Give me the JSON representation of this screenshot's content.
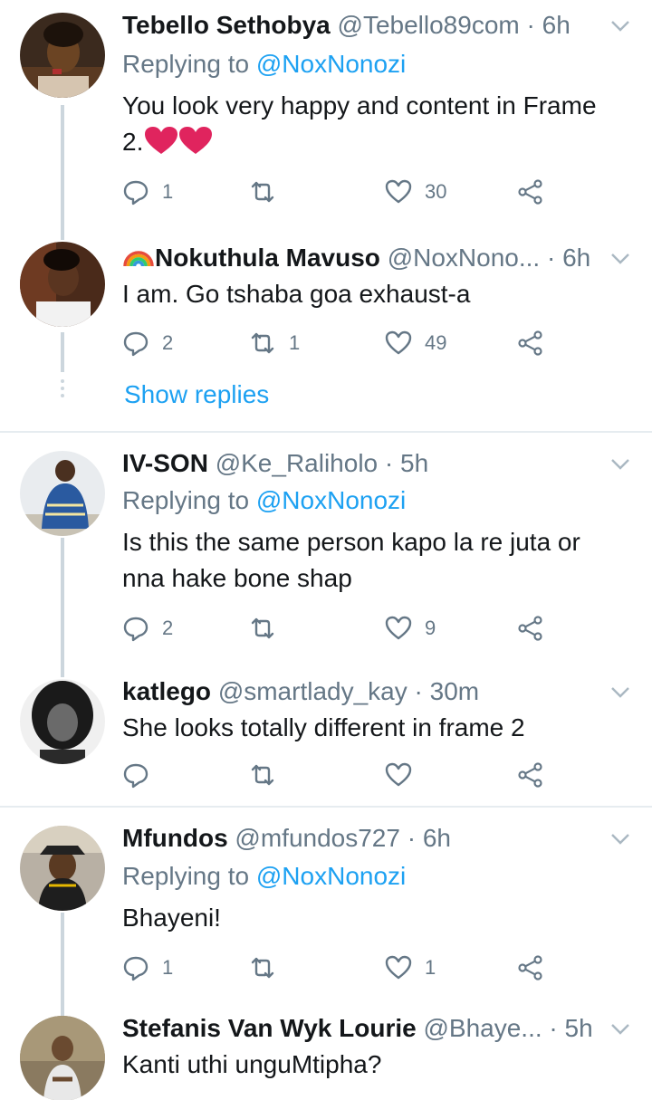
{
  "tweets": [
    {
      "name": "Tebello Sethobya",
      "handle": "@Tebello89com",
      "time": "6h",
      "replying_label": "Replying to",
      "replying_to": "@NoxNonozi",
      "text_line1": "You look very happy and content in Frame",
      "text_line2": "2.",
      "reply_count": "1",
      "retweet_count": "",
      "like_count": "30"
    },
    {
      "name_prefix_emoji": "rainbow-flag",
      "name": "Nokuthula Mavuso",
      "handle": "@NoxNono...",
      "time": "6h",
      "text": "I am. Go tshaba goa exhaust-a",
      "reply_count": "2",
      "retweet_count": "1",
      "like_count": "49"
    },
    {
      "name": "IV-SON",
      "handle": "@Ke_Raliholo",
      "time": "5h",
      "replying_label": "Replying to",
      "replying_to": "@NoxNonozi",
      "text_line1": "Is this the same person kapo la re juta or",
      "text_line2": "nna hake bone shap",
      "reply_count": "2",
      "retweet_count": "",
      "like_count": "9"
    },
    {
      "name": "katlego",
      "handle": "@smartlady_kay",
      "time": "30m",
      "text": "She looks totally different in frame 2",
      "reply_count": "",
      "retweet_count": "",
      "like_count": ""
    },
    {
      "name": "Mfundos",
      "handle": "@mfundos727",
      "time": "6h",
      "replying_label": "Replying to",
      "replying_to": "@NoxNonozi",
      "text": "Bhayeni!",
      "reply_count": "1",
      "retweet_count": "",
      "like_count": "1"
    },
    {
      "name": "Stefanis Van Wyk Lourie",
      "handle": "@Bhaye...",
      "time": "5h",
      "text": "Kanti uthi unguMtipha?"
    }
  ],
  "show_replies_label": "Show replies",
  "separator": "·",
  "colors": {
    "accent": "#1da1f2",
    "muted": "#657786",
    "text": "#14171a",
    "heart_emoji": "#e0245e",
    "divider": "#e6ecf0"
  }
}
